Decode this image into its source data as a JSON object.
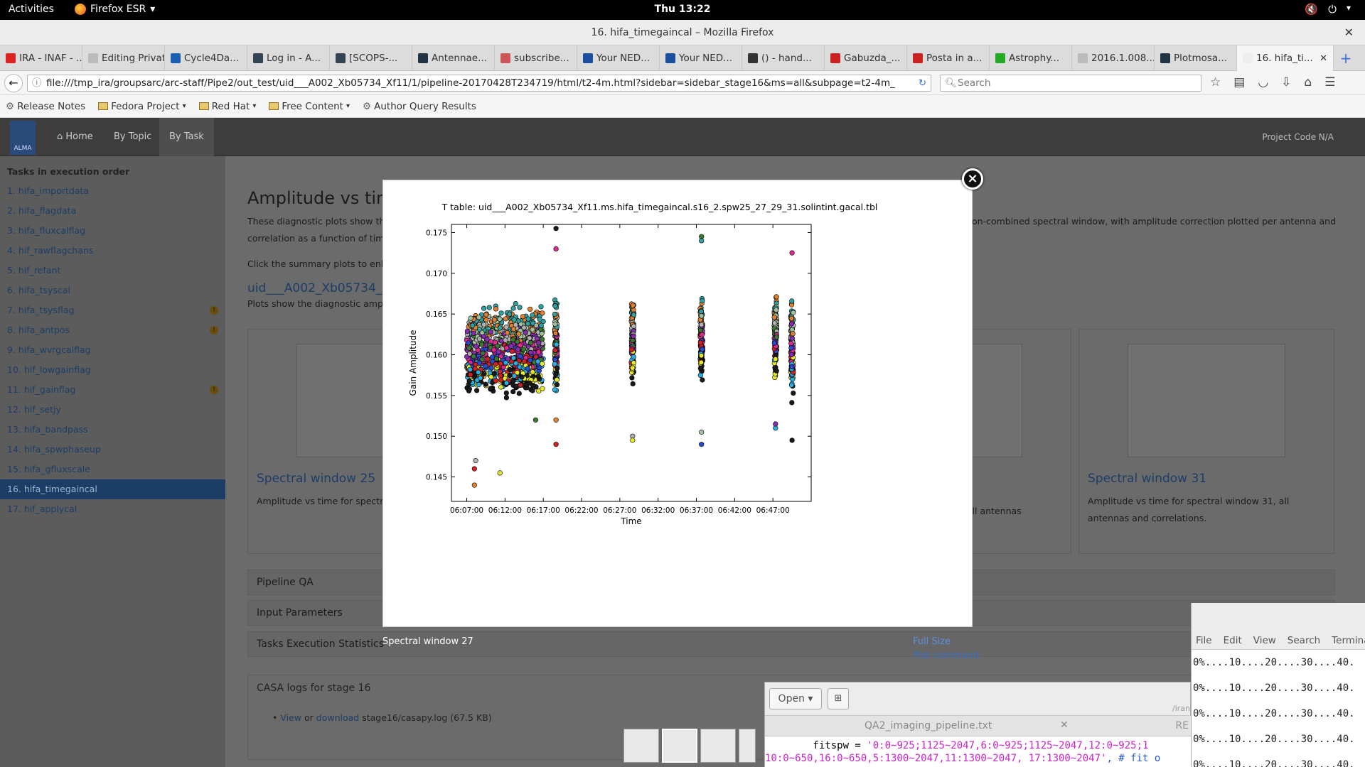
{
  "topbar": {
    "activities": "Activities",
    "app_menu": "Firefox ESR",
    "clock": "Thu 13:22"
  },
  "window": {
    "title": "16. hifa_timegaincal – Mozilla Firefox"
  },
  "tabs": [
    {
      "label": "IRA - INAF - ...",
      "color": "#d22"
    },
    {
      "label": "Editing Privat...",
      "color": "#bbb"
    },
    {
      "label": "Cycle4Da...",
      "color": "#1a5fb4"
    },
    {
      "label": "Log in - A...",
      "color": "#345"
    },
    {
      "label": "[SCOPS-...",
      "color": "#345"
    },
    {
      "label": "Antennae...",
      "color": "#234"
    },
    {
      "label": "subscribe...",
      "color": "#c55"
    },
    {
      "label": "Your NED...",
      "color": "#1a4fa0"
    },
    {
      "label": "Your NED...",
      "color": "#1a4fa0"
    },
    {
      "label": "() - hand...",
      "color": "#333"
    },
    {
      "label": "Gabuzda_...",
      "color": "#c22"
    },
    {
      "label": "Posta in a...",
      "color": "#c22"
    },
    {
      "label": "Astrophy...",
      "color": "#2a2"
    },
    {
      "label": "2016.1.008...",
      "color": "#bbb"
    },
    {
      "label": "Plotmosa...",
      "color": "#234"
    },
    {
      "label": "16. hifa_ti...",
      "color": "#eee",
      "active": true
    }
  ],
  "nav": {
    "url": "file:///tmp_ira/groupsarc/arc-staff/Pipe2/out_test/uid___A002_Xb05734_Xf11/1/pipeline-20170428T234719/html/t2-4m.html?sidebar=sidebar_stage16&ms=all&subpage=t2-4m_",
    "search_placeholder": "Search"
  },
  "bookmarks": [
    {
      "label": "Release Notes",
      "type": "icon"
    },
    {
      "label": "Fedora Project",
      "type": "folder"
    },
    {
      "label": "Red Hat",
      "type": "folder"
    },
    {
      "label": "Free Content",
      "type": "folder"
    },
    {
      "label": "Author Query Results",
      "type": "icon"
    }
  ],
  "header": {
    "logo": "ALMA",
    "home": "Home",
    "by_topic": "By Topic",
    "by_task": "By Task",
    "project_code": "Project Code N/A"
  },
  "sidebar": {
    "heading": "Tasks in execution order",
    "items": [
      {
        "label": "1. hifa_importdata"
      },
      {
        "label": "2. hifa_flagdata"
      },
      {
        "label": "3. hifa_fluxcalflag"
      },
      {
        "label": "4. hif_rawflagchans"
      },
      {
        "label": "5. hif_refant"
      },
      {
        "label": "6. hifa_tsyscal"
      },
      {
        "label": "7. hifa_tsysflag",
        "warn": true
      },
      {
        "label": "8. hifa_antpos",
        "warn": true
      },
      {
        "label": "9. hifa_wvrgcalflag"
      },
      {
        "label": "10. hif_lowgainflag"
      },
      {
        "label": "11. hif_gainflag",
        "warn": true
      },
      {
        "label": "12. hif_setjy"
      },
      {
        "label": "13. hifa_bandpass"
      },
      {
        "label": "14. hifa_spwphaseup"
      },
      {
        "label": "15. hifa_gfluxscale"
      },
      {
        "label": "16. hifa_timegaincal",
        "active": true
      },
      {
        "label": "17. hif_applycal"
      }
    ]
  },
  "content": {
    "title": "Amplitude vs time",
    "intro_left": "These diagnostic plots show the a",
    "intro_right": "on-combined spectral window, with amplitude correction plotted per antenna and",
    "intro_line2": "correlation as a function of time.",
    "click_text": "Click the summary plots to enlarg",
    "ms_link": "uid___A002_Xb05734_Xf",
    "plots_text": "Plots show the diagnostic amplitu",
    "cards": [
      {
        "title": "Spectral window 25",
        "desc": "Amplitude vs time for spectral w and correlations."
      },
      {
        "title": "",
        "desc": "9, all antennas"
      },
      {
        "title": "Spectral window 31",
        "desc": "Amplitude vs time for spectral window 31, all antennas and correlations."
      }
    ],
    "panels": [
      "Pipeline QA",
      "Input Parameters",
      "Tasks Execution Statistics"
    ],
    "casa_title": "CASA logs for stage 16",
    "casa_view": "View",
    "casa_or": " or ",
    "casa_download": "download",
    "casa_file": " stage16/casapy.log (67.5 KB)"
  },
  "lightbox": {
    "caption": "Spectral window 27",
    "full_size": "Full Size",
    "plot_command": "Plot command",
    "close": "×"
  },
  "chart_data": {
    "type": "scatter",
    "title": "T table: uid___A002_Xb05734_Xf11.ms.hifa_timegaincal.s16_2.spw25_27_29_31.solintint.gacal.tbl",
    "xlabel": "Time",
    "ylabel": "Gain Amplitude",
    "xticks": [
      "06:07:00",
      "06:12:00",
      "06:17:00",
      "06:22:00",
      "06:27:00",
      "06:32:00",
      "06:37:00",
      "06:42:00",
      "06:47:00"
    ],
    "yticks": [
      0.145,
      0.15,
      0.155,
      0.16,
      0.165,
      0.17,
      0.175
    ],
    "xlim": [
      "06:05:00",
      "06:52:00"
    ],
    "ylim": [
      0.142,
      0.176
    ],
    "grid": false,
    "scans": [
      {
        "start": "06:07:00",
        "end": "06:17:00",
        "center": 0.1605,
        "spread": 0.0065
      },
      {
        "start": "06:18:30",
        "end": "06:18:50",
        "center": 0.161,
        "spread": 0.007
      },
      {
        "start": "06:28:30",
        "end": "06:28:50",
        "center": 0.162,
        "spread": 0.006
      },
      {
        "start": "06:37:30",
        "end": "06:37:50",
        "center": 0.162,
        "spread": 0.0065
      },
      {
        "start": "06:47:10",
        "end": "06:47:30",
        "center": 0.162,
        "spread": 0.006
      },
      {
        "start": "06:49:20",
        "end": "06:49:40",
        "center": 0.161,
        "spread": 0.007
      }
    ],
    "outliers": [
      {
        "x": "06:18:40",
        "y": 0.1755
      },
      {
        "x": "06:18:40",
        "y": 0.173
      },
      {
        "x": "06:18:40",
        "y": 0.152
      },
      {
        "x": "06:18:40",
        "y": 0.149
      },
      {
        "x": "06:28:40",
        "y": 0.15
      },
      {
        "x": "06:28:40",
        "y": 0.1495
      },
      {
        "x": "06:37:40",
        "y": 0.1745
      },
      {
        "x": "06:37:40",
        "y": 0.174
      },
      {
        "x": "06:37:40",
        "y": 0.149
      },
      {
        "x": "06:37:40",
        "y": 0.1505
      },
      {
        "x": "06:47:20",
        "y": 0.151
      },
      {
        "x": "06:47:20",
        "y": 0.1515
      },
      {
        "x": "06:49:30",
        "y": 0.1495
      },
      {
        "x": "06:49:30",
        "y": 0.1725
      },
      {
        "x": "06:08:00",
        "y": 0.144
      },
      {
        "x": "06:08:00",
        "y": 0.146
      },
      {
        "x": "06:08:10",
        "y": 0.147
      },
      {
        "x": "06:11:20",
        "y": 0.1455
      },
      {
        "x": "06:16:00",
        "y": 0.152
      }
    ],
    "palette": [
      "#1a1a1a",
      "#e8e82a",
      "#2ab0e0",
      "#d02020",
      "#2a4ad0",
      "#e02890",
      "#3a7a30",
      "#8a2ab0",
      "#b0b0b0",
      "#a0c0a0",
      "#e08030",
      "#30a0a0"
    ]
  },
  "gedit": {
    "open": "Open",
    "path": "/iran",
    "tab_name": "QA2_imaging_pipeline.txt",
    "tab_right": "RE",
    "line1_prefix": "        fitspw = ",
    "line1_str": "'0:0~925;1125~2047,6:0~925;1125~2047,12:0~925;1",
    "line2_str": "10:0~650,16:0~650,5:1300~2047,11:1300~2047, 17:1300~2047'",
    "line2_comment": ", # fit o"
  },
  "terminal": {
    "menu": [
      "File",
      "Edit",
      "View",
      "Search",
      "Terminal"
    ],
    "lines": [
      "0%....10....20....30....40.",
      "0%....10....20....30....40.",
      "0%....10....20....30....40.",
      "0%....10....20....30....40.",
      "0%....10....20....30....40."
    ]
  }
}
